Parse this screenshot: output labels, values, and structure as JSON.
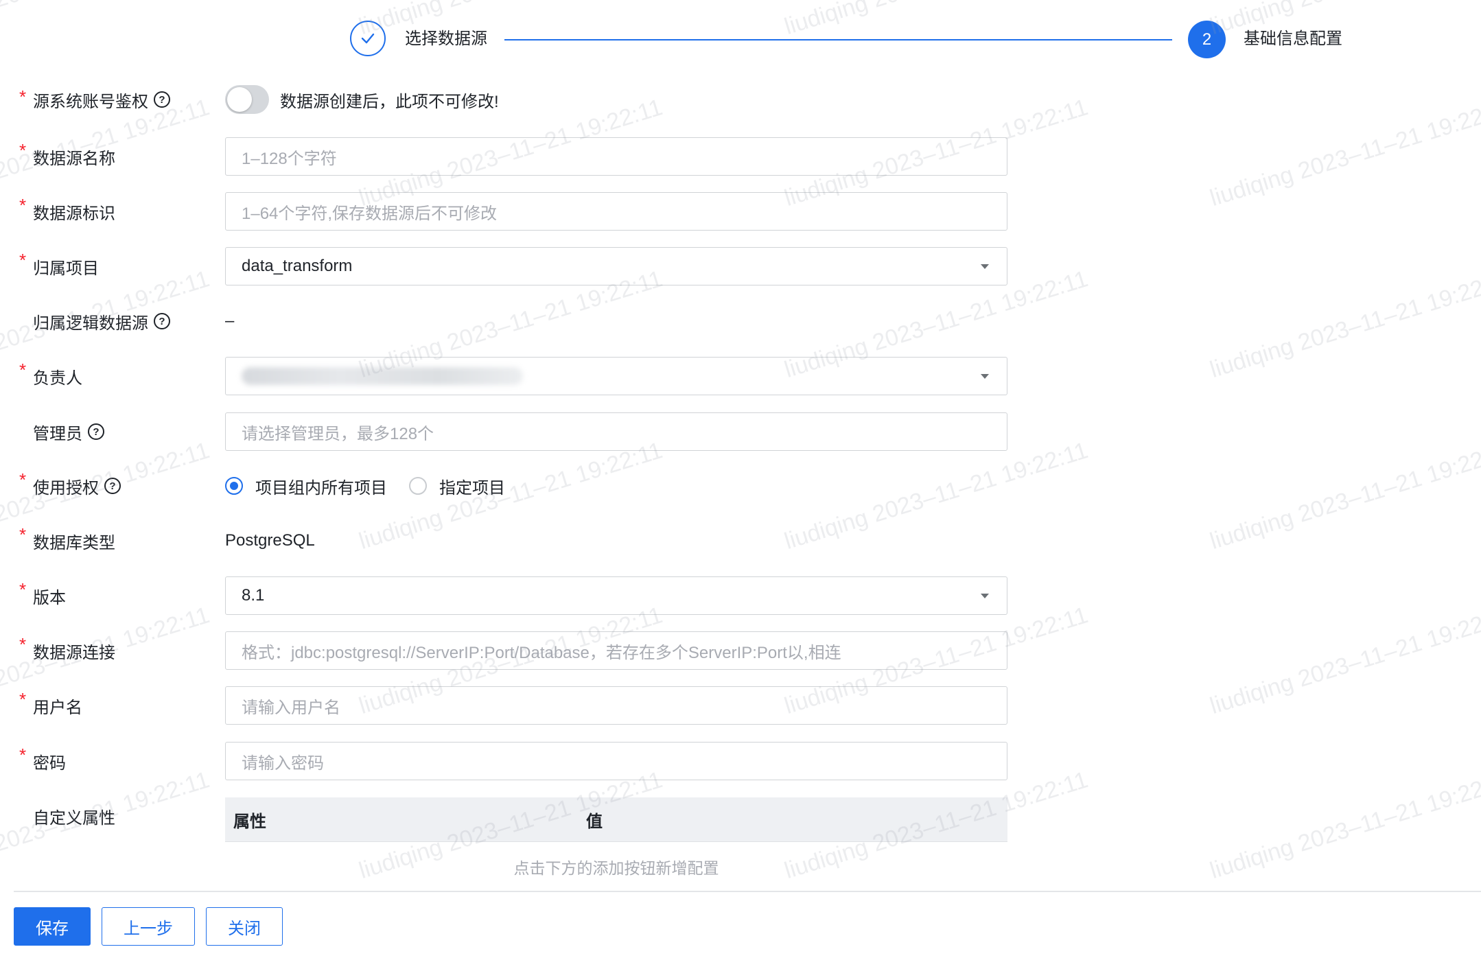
{
  "steps": [
    {
      "label": "选择数据源",
      "state": "done",
      "icon": "check-icon"
    },
    {
      "number": "2",
      "label": "基础信息配置",
      "state": "active"
    }
  ],
  "form": {
    "auth": {
      "label": "源系统账号鉴权",
      "required": true,
      "toggle_on": false,
      "hint": "数据源创建后，此项不可修改!"
    },
    "name": {
      "label": "数据源名称",
      "required": true,
      "placeholder": "1–128个字符"
    },
    "identifier": {
      "label": "数据源标识",
      "required": true,
      "placeholder": "1–64个字符,保存数据源后不可修改"
    },
    "project": {
      "label": "归属项目",
      "required": true,
      "value": "data_transform"
    },
    "logical_source": {
      "label": "归属逻辑数据源",
      "required": false,
      "value": "–"
    },
    "owner": {
      "label": "负责人",
      "required": true
    },
    "admins": {
      "label": "管理员",
      "required": false,
      "placeholder": "请选择管理员，最多128个"
    },
    "authorization": {
      "label": "使用授权",
      "required": true,
      "options": [
        "项目组内所有项目",
        "指定项目"
      ],
      "selected": "项目组内所有项目"
    },
    "db_type": {
      "label": "数据库类型",
      "required": true,
      "value": "PostgreSQL"
    },
    "version": {
      "label": "版本",
      "required": true,
      "value": "8.1"
    },
    "connection": {
      "label": "数据源连接",
      "required": true,
      "placeholder": "格式：jdbc:postgresql://ServerIP:Port/Database，若存在多个ServerIP:Port以,相连"
    },
    "username": {
      "label": "用户名",
      "required": true,
      "placeholder": "请输入用户名"
    },
    "password": {
      "label": "密码",
      "required": true,
      "placeholder": "请输入密码"
    },
    "custom_props": {
      "label": "自定义属性",
      "columns": [
        "属性",
        "值"
      ],
      "empty_text": "点击下方的添加按钮新增配置"
    }
  },
  "help_glyph": "?",
  "required_mark": "*",
  "footer": {
    "save": "保存",
    "prev": "上一步",
    "close": "关闭"
  },
  "watermark": "liudiqing 2023–11–21 19:22:11",
  "colors": {
    "primary": "#1f6feb",
    "required": "#f5222d",
    "placeholder": "#a8abb2"
  }
}
